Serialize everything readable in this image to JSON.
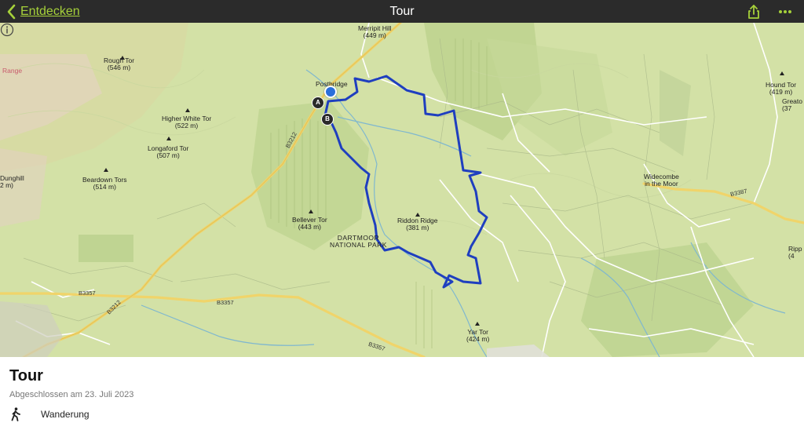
{
  "topbar": {
    "back_label": "Entdecken",
    "title": "Tour",
    "accent_color": "#a6d13a",
    "share_icon": "share-icon",
    "more_icon": "more-icon"
  },
  "map": {
    "labels": {
      "merripit": "Merripit Hill",
      "merripit_h": "(449 m)",
      "rough": "Rough Tor",
      "rough_h": "(546 m)",
      "range": "Range",
      "higher_white": "Higher White Tor",
      "higher_white_h": "(522 m)",
      "longaford": "Longaford Tor",
      "longaford_h": "(507 m)",
      "dunghill": "Dunghill",
      "dunghill_h": "2 m)",
      "beardown": "Beardown Tors",
      "beardown_h": "(514 m)",
      "postbridge": "Postbridge",
      "bellever": "Bellever Tor",
      "bellever_h": "(443 m)",
      "riddon": "Riddon Ridge",
      "riddon_h": "(381 m)",
      "dartmoor1": "DARTMOOR",
      "dartmoor2": "NATIONAL PARK",
      "hound": "Hound Tor",
      "hound_h": "(419 m)",
      "greator": "Greato",
      "greator_h": "(37",
      "widecombe1": "Widecombe",
      "widecombe2": "in the Moor",
      "ripp": "Ripp",
      "ripp_h": "(4",
      "yar": "Yar Tor",
      "yar_h": "(424 m)",
      "b3212_a": "B3212",
      "b3212_b": "B3212",
      "b3357_a": "B3357",
      "b3357_b": "B3357",
      "b3357_c": "B3357",
      "b3387": "B3387"
    },
    "marker_a": "A",
    "marker_b": "B",
    "route_color": "#1f3fbf"
  },
  "panel": {
    "title": "Tour",
    "date": "Abgeschlossen am 23. Juli 2023",
    "activity_icon": "hiking-icon",
    "activity": "Wanderung"
  }
}
